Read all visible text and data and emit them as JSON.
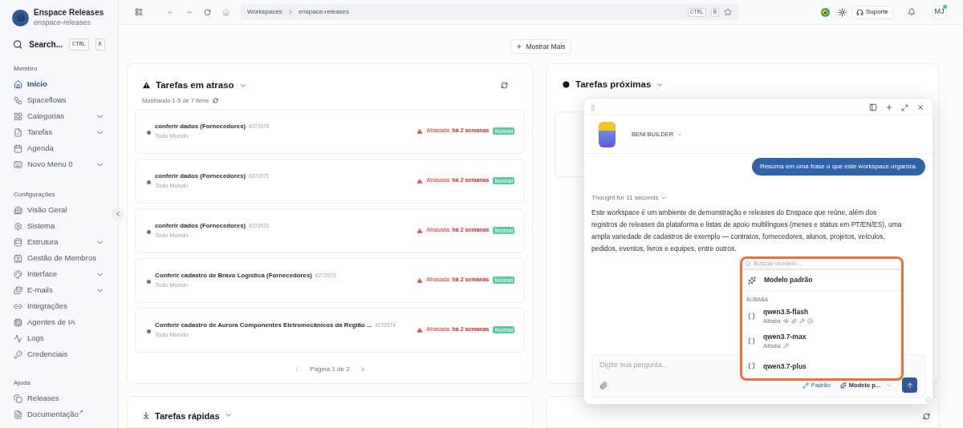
{
  "workspace": {
    "name": "Enspace Releases",
    "slug": "enspace-releases"
  },
  "search": {
    "placeholder": "Search...",
    "keys": [
      "CTRL",
      "K"
    ]
  },
  "sidebar": {
    "sections": [
      {
        "title": "Membro",
        "items": [
          {
            "label": "Início",
            "selected": true,
            "expandable": false
          },
          {
            "label": "Spaceflows",
            "selected": false,
            "expandable": false
          },
          {
            "label": "Categorias",
            "selected": false,
            "expandable": true
          },
          {
            "label": "Tarefas",
            "selected": false,
            "expandable": true
          },
          {
            "label": "Agenda",
            "selected": false,
            "expandable": false
          },
          {
            "label": "Novo Menu 0",
            "selected": false,
            "expandable": true
          }
        ]
      },
      {
        "title": "Configurações",
        "items": [
          {
            "label": "Visão Geral",
            "selected": false,
            "expandable": false
          },
          {
            "label": "Sistema",
            "selected": false,
            "expandable": false
          },
          {
            "label": "Estrutura",
            "selected": false,
            "expandable": true
          },
          {
            "label": "Gestão de Membros",
            "selected": false,
            "expandable": false
          },
          {
            "label": "Interface",
            "selected": false,
            "expandable": true
          },
          {
            "label": "E-mails",
            "selected": false,
            "expandable": true
          },
          {
            "label": "Integrações",
            "selected": false,
            "expandable": false
          },
          {
            "label": "Agentes de IA",
            "selected": false,
            "expandable": false
          },
          {
            "label": "Logs",
            "selected": false,
            "expandable": false
          },
          {
            "label": "Credenciais",
            "selected": false,
            "expandable": false
          }
        ]
      },
      {
        "title": "Ajuda",
        "items": [
          {
            "label": "Releases",
            "selected": false,
            "expandable": false
          },
          {
            "label": "Documentação",
            "selected": false,
            "expandable": false,
            "suffix": "↗"
          }
        ]
      }
    ]
  },
  "topbar": {
    "breadcrumb": [
      "Workspaces",
      "enspace-releases"
    ],
    "keys": [
      "CTRL",
      "B"
    ],
    "support": "Suporte",
    "avatar": "MJ",
    "online": true
  },
  "show_more": "Mostrar Mais",
  "overdue": {
    "title": "Tarefas em atraso",
    "showing": "Mostrando 1-5 de 7 itens",
    "pagination": "Página 1 de 2",
    "tasks": [
      {
        "title": "conferir dados (Fornecedores)",
        "id": "#272970",
        "assignee": "Todo Mundo",
        "due": "Atrasada: **há 2 semanas**",
        "priority": "Normal"
      },
      {
        "title": "conferir dados (Fornecedores)",
        "id": "#272971",
        "assignee": "Todo Mundo",
        "due": "Atrasada: **há 2 semanas**",
        "priority": "Normal"
      },
      {
        "title": "conferir dados (Fornecedores)",
        "id": "#272972",
        "assignee": "Todo Mundo",
        "due": "Atrasada: **há 2 semanas**",
        "priority": "Normal"
      },
      {
        "title": "Conferir cadastro de Bravo Logística (Fornecedores)",
        "id": "#272973",
        "assignee": "Todo Mundo",
        "due": "Atrasada: **há 2 semanas**",
        "priority": "Normal"
      },
      {
        "title": "Conferir cadastro de Aurora Componentes Eletromecânicos da Região ...",
        "id": "#272974",
        "assignee": "Todo Mundo",
        "due": "Atrasada: **há 2 semanas**",
        "priority": "Normal"
      }
    ]
  },
  "upcoming": {
    "title": "Tarefas próximas"
  },
  "quick": {
    "title": "Tarefas rápidas"
  },
  "chat": {
    "agent": "BENI BUILDER",
    "user_message": "Resuma em uma frase o que este workspace organiza.",
    "thought": "Thought for 11 seconds",
    "answer": "Este workspace é um ambiente de demonstração e releases do Enspace que reúne, além dos registros de releases da plataforma e listas de apoio multilíngues (meses e status em PT/EN/ES), uma ampla variedade de cadastros de exemplo — contratos, fornecedores, alunos, projetos, veículos, pedidos, eventos, livros e equipes, entre outros.",
    "input_placeholder": "Digite sua pergunta...",
    "mode": "Padrão",
    "model": "Modelo p..."
  },
  "model_menu": {
    "placeholder": "Buscar modelo...",
    "default": "Modelo padrão",
    "group": "ALIBABA",
    "models": [
      {
        "name": "qwen3.5-flash",
        "provider": "Alibaba"
      },
      {
        "name": "qwen3.7-max",
        "provider": "Alibaba"
      },
      {
        "name": "qwen3.7-plus"
      }
    ]
  }
}
